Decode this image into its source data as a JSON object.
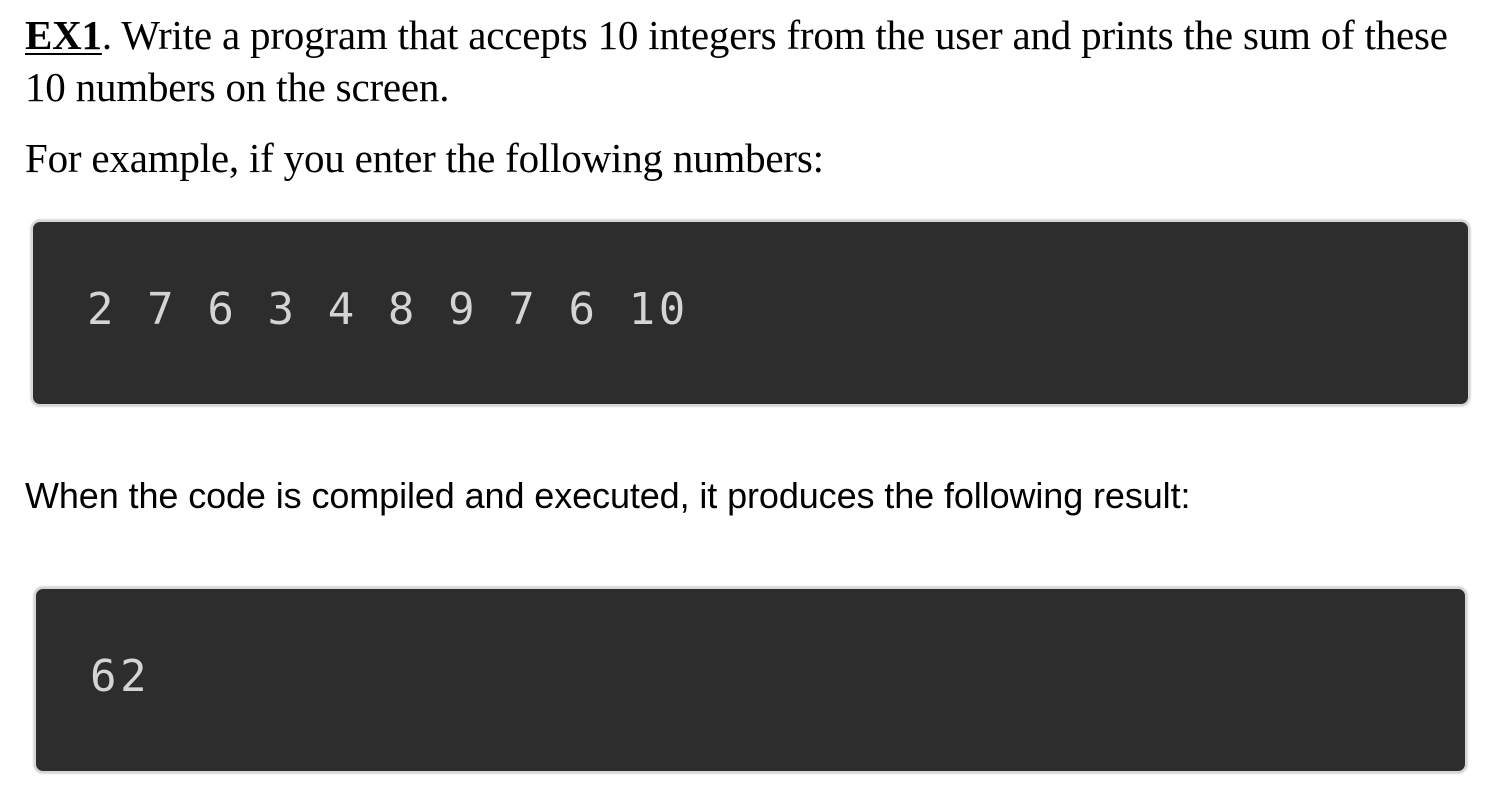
{
  "exercise": {
    "label": "EX1",
    "separator": ".",
    "statement": " Write a program that accepts 10 integers from the user and prints the sum of these 10 numbers on the screen."
  },
  "example_intro": "For example, if you enter the following numbers:",
  "input_console": {
    "text": "2 7 6 3 4 8 9 7 6 10"
  },
  "result_intro": "When the code is compiled and executed, it produces the following result:",
  "output_console": {
    "text": "62"
  },
  "colors": {
    "console_background": "#2d2d2d",
    "console_text": "#d4d4d4",
    "console_border": "#d6d6d6"
  }
}
